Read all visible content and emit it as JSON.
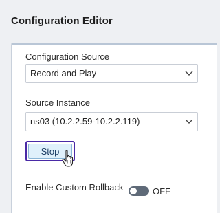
{
  "page": {
    "title": "Configuration Editor"
  },
  "config_source": {
    "label": "Configuration Source",
    "value": "Record and Play"
  },
  "source_instance": {
    "label": "Source Instance",
    "value": "ns03 (10.2.2.59-10.2.2.119)"
  },
  "actions": {
    "stop_label": "Stop"
  },
  "rollback": {
    "label": "Enable Custom Rollback",
    "state_label": "OFF",
    "enabled": false
  },
  "icons": {
    "chevron": "chevron-down-icon",
    "cursor": "hand-pointer-icon"
  },
  "colors": {
    "page_background": "#eef0f3",
    "panel_border": "#b9c6d6",
    "button_focus_ring": "#4a2aa6",
    "button_fill": "#dff0fb",
    "toggle_off": "#5f6a78"
  }
}
